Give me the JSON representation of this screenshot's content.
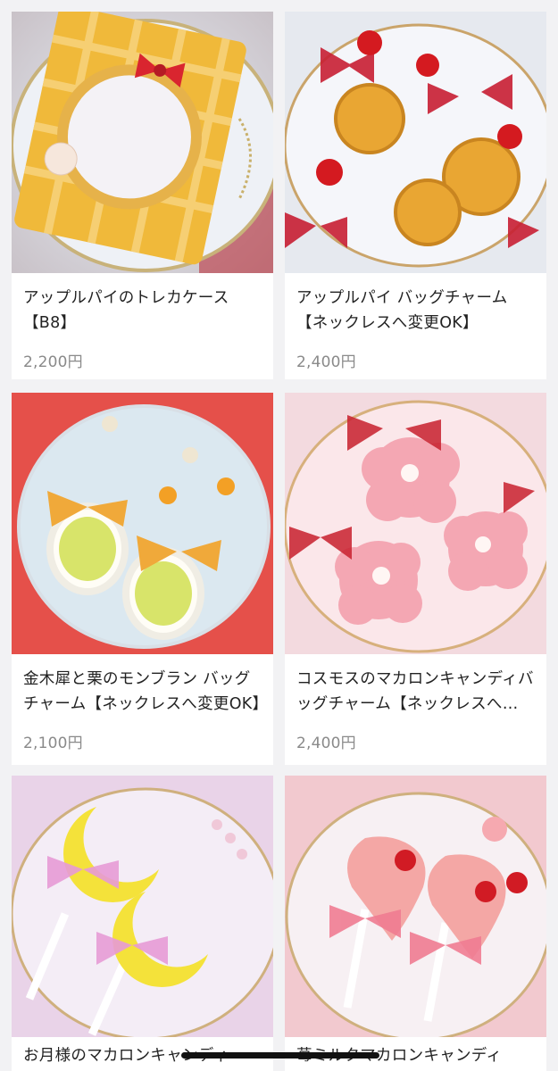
{
  "products": [
    {
      "title": "アップルパイのトレカケース【B8】",
      "price": "2,200円",
      "image": "apple-pie-card-case-photo"
    },
    {
      "title": "アップルパイ バッグチャーム【ネックレスへ変更OK】",
      "price": "2,400円",
      "image": "apple-pie-bag-charm-photo"
    },
    {
      "title": "金木犀と栗のモンブラン バッグチャーム【ネックレスへ変更OK】",
      "price": "2,100円",
      "image": "montblanc-bag-charm-photo"
    },
    {
      "title": "コスモスのマカロンキャンディバッグチャーム【ネックレスへ…",
      "price": "2,400円",
      "image": "cosmos-macaron-candy-photo"
    },
    {
      "title": "お月様のマカロンキャンディ",
      "price": "",
      "image": "moon-macaron-candy-photo"
    },
    {
      "title": "苺ミルクマカロンキャンディ",
      "price": "",
      "image": "strawberry-milk-macaron-candy-photo"
    }
  ],
  "colors": {
    "background": "#f2f2f4",
    "card": "#ffffff",
    "title_text": "#222222",
    "price_text": "#8a8a8a"
  }
}
